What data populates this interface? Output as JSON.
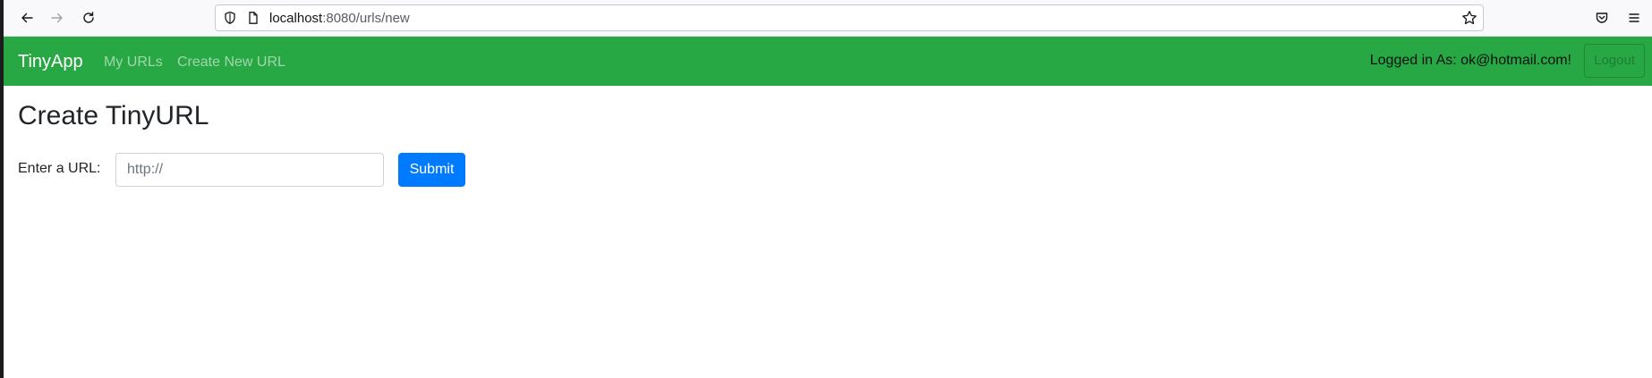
{
  "browser": {
    "url_host": "localhost",
    "url_path": ":8080/urls/new",
    "icons": {
      "back": "arrow-left",
      "forward": "arrow-right",
      "reload": "reload",
      "security": "shield",
      "page": "page",
      "bookmark": "star",
      "pocket": "pocket",
      "menu": "hamburger"
    }
  },
  "navbar": {
    "brand": "TinyApp",
    "links": [
      {
        "label": "My URLs"
      },
      {
        "label": "Create New URL"
      }
    ],
    "logged_in_text": "Logged in As: ok@hotmail.com!",
    "logout_label": "Logout",
    "background_color": "#28a745"
  },
  "main": {
    "title": "Create TinyURL",
    "form": {
      "label": "Enter a URL:",
      "input_value": "",
      "input_placeholder": "http://",
      "submit_label": "Submit",
      "submit_color": "#007bff"
    }
  }
}
